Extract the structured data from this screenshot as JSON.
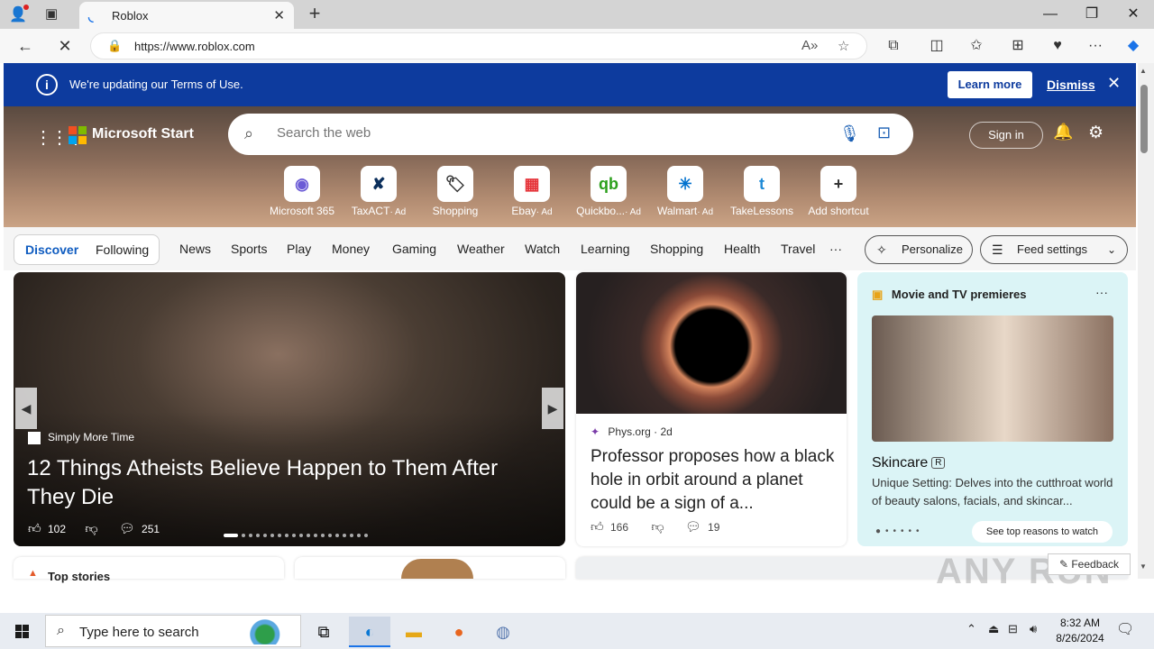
{
  "browser": {
    "tab_title": "Roblox",
    "url": "https://www.roblox.com",
    "new_tab_symbol": "+",
    "window_controls": [
      "—",
      "❐",
      "✕"
    ]
  },
  "notice": {
    "message": "We're updating our Terms of Use.",
    "learn_more": "Learn more",
    "dismiss": "Dismiss"
  },
  "header": {
    "brand": "Microsoft Start",
    "search_placeholder": "Search the web",
    "sign_in": "Sign in"
  },
  "quick_links": [
    {
      "label": "Microsoft 365",
      "ad": "",
      "icon": "microsoft-365-icon",
      "glyph": "◉",
      "color": "#6b5bd6"
    },
    {
      "label": "TaxACT",
      "ad": "· Ad",
      "icon": "taxact-icon",
      "glyph": "✘",
      "color": "#0b2f5c"
    },
    {
      "label": "Shopping",
      "ad": "",
      "icon": "shopping-tag-icon",
      "glyph": "🏷",
      "color": "#333333"
    },
    {
      "label": "Ebay",
      "ad": "· Ad",
      "icon": "ebay-icon",
      "glyph": "▦",
      "color": "#e53238"
    },
    {
      "label": "Quickbo...",
      "ad": "· Ad",
      "icon": "quickbooks-icon",
      "glyph": "qb",
      "color": "#2ca01c"
    },
    {
      "label": "Walmart",
      "ad": "· Ad",
      "icon": "walmart-icon",
      "glyph": "✳",
      "color": "#0071ce"
    },
    {
      "label": "TakeLessons",
      "ad": "",
      "icon": "takelessons-icon",
      "glyph": "t",
      "color": "#1e8ad6"
    },
    {
      "label": "Add shortcut",
      "ad": "",
      "icon": "plus-icon",
      "glyph": "+",
      "color": "#333333"
    }
  ],
  "feed_nav": {
    "discover": "Discover",
    "following": "Following",
    "categories": [
      "News",
      "Sports",
      "Play",
      "Money",
      "Gaming",
      "Weather",
      "Watch",
      "Learning",
      "Shopping",
      "Health",
      "Travel"
    ],
    "more": "···",
    "personalize": "Personalize",
    "feed_settings": "Feed settings"
  },
  "main_story": {
    "source": "Simply More Time",
    "headline": "12 Things Atheists Believe Happen to Them After They Die",
    "likes": "102",
    "comments": "251",
    "slide_count": 19,
    "active_slide": 1
  },
  "mid_story": {
    "source": "Phys.org",
    "age": "2d",
    "headline": "Professor proposes how a black hole in orbit around a planet could be a sign of a...",
    "likes": "166",
    "comments": "19"
  },
  "movie_card": {
    "header": "Movie and TV premieres",
    "title": "Skincare",
    "rating": "R",
    "description": "Unique Setting: Delves into the cutthroat world of beauty salons, facials, and skincar...",
    "button": "See top reasons to watch"
  },
  "lower": {
    "top_stories": "Top stories",
    "feedback": "Feedback"
  },
  "watermark": "ANY RUN",
  "taskbar": {
    "search_placeholder": "Type here to search",
    "time": "8:32 AM",
    "date": "8/26/2024"
  }
}
